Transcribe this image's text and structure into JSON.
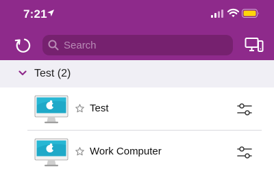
{
  "status_bar": {
    "time": "7:21",
    "icons": [
      "location-arrow-icon",
      "signal-icon",
      "wifi-icon",
      "battery-icon"
    ]
  },
  "toolbar": {
    "refresh_icon": "refresh-icon",
    "search_placeholder": "Search",
    "screens_icon": "screens-icon"
  },
  "group": {
    "title": "Test (2)",
    "expanded": true
  },
  "devices": [
    {
      "name": "Test",
      "icon": "imac-icon",
      "favorite": false
    },
    {
      "name": "Work Computer",
      "icon": "imac-icon",
      "favorite": false
    }
  ],
  "colors": {
    "header": "#8e2a8b",
    "search_bg": "#76216f",
    "accent": "#8e2a8b",
    "battery": "#ffd60a"
  }
}
